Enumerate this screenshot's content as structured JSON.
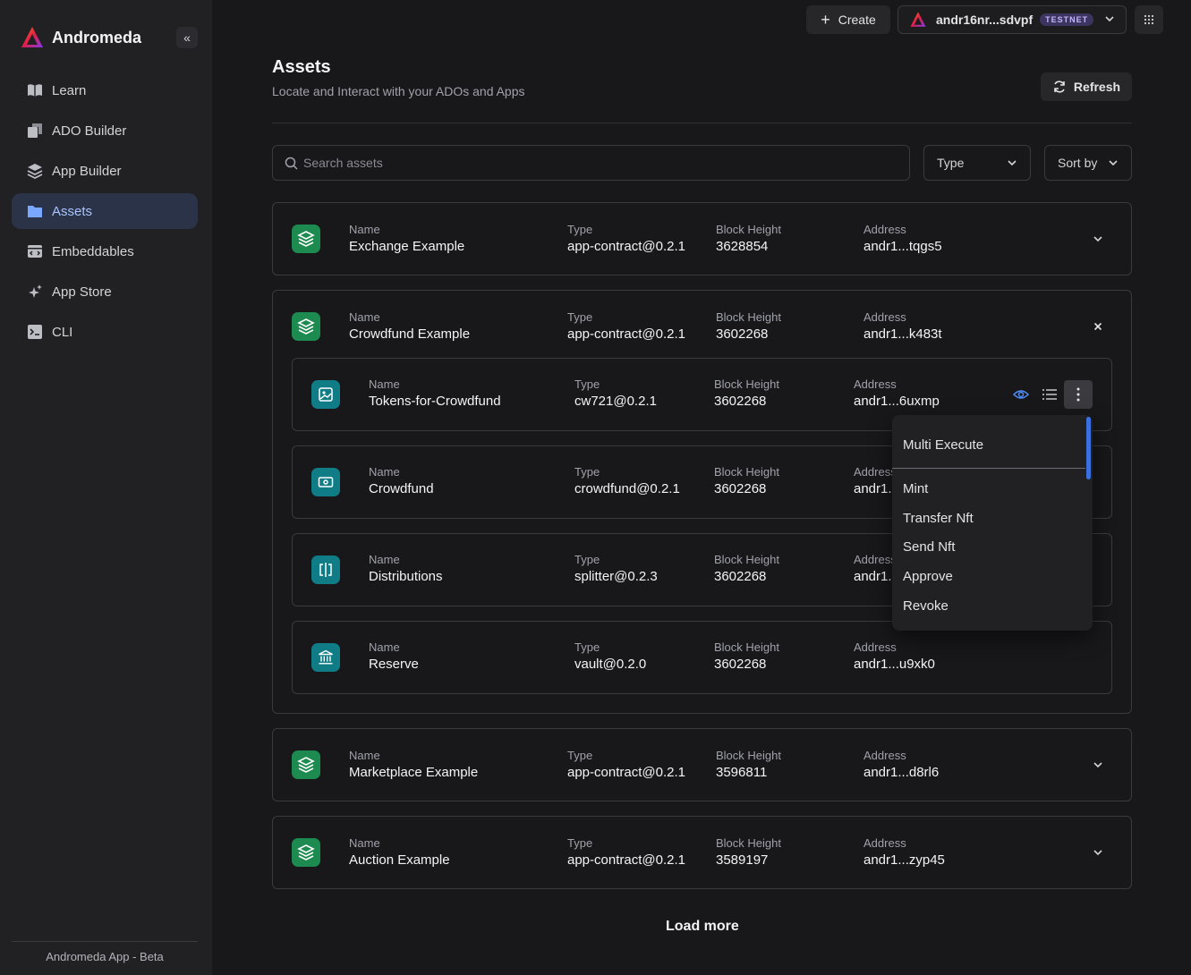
{
  "sidebar": {
    "brand": "Andromeda",
    "items": [
      {
        "label": "Learn",
        "icon": "book-icon"
      },
      {
        "label": "ADO Builder",
        "icon": "blocks-icon"
      },
      {
        "label": "App Builder",
        "icon": "layers-icon"
      },
      {
        "label": "Assets",
        "icon": "folder-icon",
        "active": true
      },
      {
        "label": "Embeddables",
        "icon": "embed-icon"
      },
      {
        "label": "App Store",
        "icon": "sparkles-icon"
      },
      {
        "label": "CLI",
        "icon": "terminal-icon"
      }
    ],
    "footer": "Andromeda App - Beta"
  },
  "topbar": {
    "create_label": "Create",
    "wallet_address": "andr16nr...sdvpf",
    "network_badge": "TESTNET"
  },
  "header": {
    "title": "Assets",
    "subtitle": "Locate and Interact with your ADOs and Apps",
    "refresh_label": "Refresh"
  },
  "filters": {
    "search_placeholder": "Search assets",
    "type_label": "Type",
    "sort_label": "Sort by"
  },
  "labels": {
    "name": "Name",
    "type": "Type",
    "block_height": "Block Height",
    "address": "Address"
  },
  "apps": [
    {
      "name": "Exchange Example",
      "type": "app-contract@0.2.1",
      "block_height": "3628854",
      "address": "andr1...tqgs5"
    },
    {
      "name": "Crowdfund Example",
      "type": "app-contract@0.2.1",
      "block_height": "3602268",
      "address": "andr1...k483t",
      "components": [
        {
          "name": "Tokens-for-Crowdfund",
          "type": "cw721@0.2.1",
          "block_height": "3602268",
          "address": "andr1...6uxmp"
        },
        {
          "name": "Crowdfund",
          "type": "crowdfund@0.2.1",
          "block_height": "3602268",
          "address": "andr1..."
        },
        {
          "name": "Distributions",
          "type": "splitter@0.2.3",
          "block_height": "3602268",
          "address": "andr1..."
        },
        {
          "name": "Reserve",
          "type": "vault@0.2.0",
          "block_height": "3602268",
          "address": "andr1...u9xk0"
        }
      ]
    },
    {
      "name": "Marketplace Example",
      "type": "app-contract@0.2.1",
      "block_height": "3596811",
      "address": "andr1...d8rl6"
    },
    {
      "name": "Auction Example",
      "type": "app-contract@0.2.1",
      "block_height": "3589197",
      "address": "andr1...zyp45"
    }
  ],
  "menu": {
    "header": "Multi Execute",
    "items": [
      "Mint",
      "Transfer Nft",
      "Send Nft",
      "Approve",
      "Revoke"
    ]
  },
  "load_more_label": "Load more",
  "colors": {
    "background": "#18181b",
    "sidebar": "#212124",
    "active_nav": "#2a3348",
    "app_icon": "#1d8a50",
    "ado_icon": "#0f7c86",
    "accent": "#3b6fe0"
  }
}
